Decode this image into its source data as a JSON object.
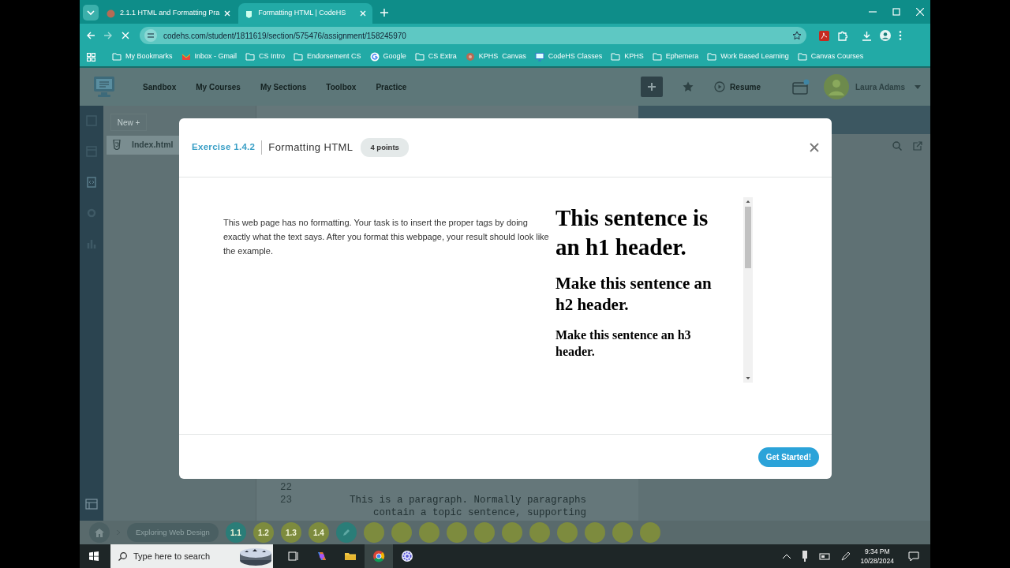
{
  "browser": {
    "tabs": [
      {
        "title": "2.1.1 HTML and Formatting Pra",
        "selected": false
      },
      {
        "title": "Formatting HTML | CodeHS",
        "selected": true
      }
    ],
    "url": "codehs.com/student/1811619/section/575476/assignment/158245970",
    "bookmarks": [
      {
        "label": "My Bookmarks",
        "kind": "folder"
      },
      {
        "label": "Inbox - Gmail",
        "kind": "mail"
      },
      {
        "label": "CS Intro",
        "kind": "folder"
      },
      {
        "label": "Endorsement CS",
        "kind": "folder"
      },
      {
        "label": "Google",
        "kind": "google"
      },
      {
        "label": "CS Extra",
        "kind": "folder"
      },
      {
        "label": "KPHS  Canvas",
        "kind": "globe"
      },
      {
        "label": "CodeHS Classes",
        "kind": "monitor"
      },
      {
        "label": "KPHS",
        "kind": "folder"
      },
      {
        "label": "Ephemera",
        "kind": "folder"
      },
      {
        "label": "Work Based Learning",
        "kind": "folder"
      },
      {
        "label": "Canvas Courses",
        "kind": "folder"
      }
    ]
  },
  "header": {
    "nav": [
      "Sandbox",
      "My Courses",
      "My Sections",
      "Toolbox",
      "Practice"
    ],
    "resume": "Resume",
    "user": "Laura Adams"
  },
  "files": {
    "new_button": "New +",
    "items": [
      {
        "name": "Index.html",
        "selected": true
      }
    ]
  },
  "editor": {
    "lines": [
      {
        "number": "22"
      },
      {
        "number": "23",
        "code": "This is a paragraph. Normally paragraphs contain a topic sentence, supporting"
      }
    ]
  },
  "lesson_bar": {
    "course": "Exploring Web Design",
    "lessons": [
      {
        "kind": "lesson",
        "label": "1.1",
        "color": "#2a7d78"
      },
      {
        "kind": "lesson",
        "label": "1.2",
        "color": "#7d8b3e"
      },
      {
        "kind": "lesson",
        "label": "1.3",
        "color": "#7d8b3e"
      },
      {
        "kind": "lesson",
        "label": "1.4",
        "color": "#7d8b3e"
      },
      {
        "kind": "exercise",
        "color": "#2a7d78"
      },
      {
        "kind": "lesson",
        "color": "#7d8b3e"
      },
      {
        "kind": "lesson",
        "color": "#7d8b3e"
      },
      {
        "kind": "lesson",
        "color": "#7d8b3e"
      },
      {
        "kind": "lesson",
        "color": "#7d8b3e"
      },
      {
        "kind": "lesson",
        "color": "#7d8b3e"
      },
      {
        "kind": "lesson",
        "color": "#7d8b3e"
      },
      {
        "kind": "lesson",
        "color": "#7d8b3e"
      },
      {
        "kind": "lesson",
        "color": "#7d8b3e"
      },
      {
        "kind": "lesson",
        "color": "#7d8b3e"
      },
      {
        "kind": "lesson",
        "color": "#7d8b3e"
      },
      {
        "kind": "lesson",
        "color": "#7d8b3e"
      }
    ]
  },
  "modal": {
    "exercise": "Exercise 1.4.2",
    "title": "Formatting HTML",
    "points": "4 points",
    "description": "This web page has no formatting. Your task is to insert the proper tags by doing exactly what the text says. After you format this webpage, your result should look like the example.",
    "example": [
      {
        "kind": "h1",
        "text": "This sentence is an h1 header."
      },
      {
        "kind": "h2",
        "text": "Make this sentence an h2 header."
      },
      {
        "kind": "h3",
        "text": "Make this sentence an h3 header."
      }
    ],
    "button": "Get Started!"
  },
  "taskbar": {
    "search_placeholder": "Type here to search",
    "time": "9:34 PM",
    "date": "10/28/2024"
  }
}
